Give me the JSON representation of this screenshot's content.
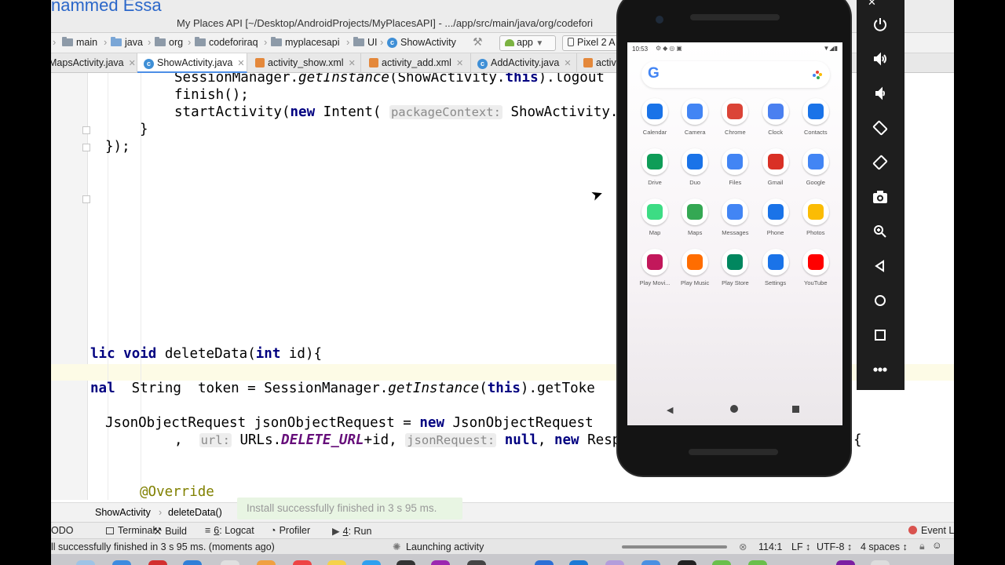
{
  "presenter_name": "nammed Essa",
  "window_title": "My Places API [~/Desktop/AndroidProjects/MyPlacesAPI] - .../app/src/main/java/org/codefori",
  "navbar": {
    "crumbs": [
      "main",
      "java",
      "org",
      "codeforiraq",
      "myplacesapi",
      "UI",
      "ShowActivity"
    ],
    "run_config": "app",
    "device": "Pixel 2 A"
  },
  "tabs": [
    {
      "label": "MapsActivity.java",
      "type": "class"
    },
    {
      "label": "ShowActivity.java",
      "type": "class",
      "active": true
    },
    {
      "label": "activity_show.xml",
      "type": "xml"
    },
    {
      "label": "activity_add.xml",
      "type": "xml"
    },
    {
      "label": "AddActivity.java",
      "type": "class"
    },
    {
      "label": "activi",
      "type": "xml"
    }
  ],
  "code": {
    "line1_a": "SessionManager.",
    "line1_b": "getInstance",
    "line1_c": "(ShowActivity.",
    "line1_d": "this",
    "line1_e": ").logout",
    "line2": "finish();",
    "line3_a": "startActivity(",
    "line3_b": "new",
    "line3_c": " Intent( ",
    "line3_hint": "packageContext:",
    "line3_d": " ShowActivity.",
    "line4": "}",
    "line5": "});",
    "line6_a": "lic",
    "line6_b": "void",
    "line6_c": " deleteData(",
    "line6_d": "int",
    "line6_e": " id){",
    "line7_a": "nal",
    "line7_b": "  String  token = SessionManager.",
    "line7_c": "getInstance",
    "line7_d": "(",
    "line7_e": "this",
    "line7_f": ").getToke",
    "line8_a": "JsonObjectRequest jsonObjectRequest = ",
    "line8_b": "new",
    "line8_c": " JsonObjectRequest",
    "line9_a": ", ",
    "line9_hint1": "url:",
    "line9_b": " URLs.",
    "line9_c": "DELETE_URL",
    "line9_d": "+id, ",
    "line9_hint2": "jsonRequest:",
    "line9_e": "null",
    "line9_f": ", ",
    "line9_g": "new",
    "line9_h": " Respo",
    "line9_brace": "{",
    "line10": "@Override"
  },
  "toast": "Install successfully finished in 3 s 95 ms.",
  "code_breadcrumb": [
    "ShowActivity",
    "deleteData()"
  ],
  "tool_windows": {
    "todo": "ODO",
    "terminal": "Terminal",
    "build": "Build",
    "logcat_num": "6",
    "logcat": ": Logcat",
    "profiler": "Profiler",
    "run_num": "4",
    "run": ": Run",
    "event_log": "Event Lo"
  },
  "status": {
    "message": "ll successfully finished in 3 s 95 ms. (moments ago)",
    "task": "Launching activity",
    "position": "114:1",
    "line_sep": "LF ↕",
    "encoding": "UTF-8 ↕",
    "indent": "4 spaces ↕"
  },
  "phone": {
    "time": "10:53",
    "apps": [
      {
        "label": "Calendar",
        "icon": "calendar-icon",
        "color": "#1a73e8"
      },
      {
        "label": "Camera",
        "icon": "camera-icon",
        "color": "#4285f4"
      },
      {
        "label": "Chrome",
        "icon": "chrome-icon",
        "color": "#db4437"
      },
      {
        "label": "Clock",
        "icon": "clock-icon",
        "color": "#4a80f0"
      },
      {
        "label": "Contacts",
        "icon": "contacts-icon",
        "color": "#1a73e8"
      },
      {
        "label": "Drive",
        "icon": "drive-icon",
        "color": "#0f9d58"
      },
      {
        "label": "Duo",
        "icon": "duo-icon",
        "color": "#1a73e8"
      },
      {
        "label": "Files",
        "icon": "files-icon",
        "color": "#4285f4"
      },
      {
        "label": "Gmail",
        "icon": "gmail-icon",
        "color": "#d93025"
      },
      {
        "label": "Google",
        "icon": "google-icon",
        "color": "#4285f4"
      },
      {
        "label": "Map",
        "icon": "android-icon",
        "color": "#3ddc84"
      },
      {
        "label": "Maps",
        "icon": "maps-icon",
        "color": "#34a853"
      },
      {
        "label": "Messages",
        "icon": "messages-icon",
        "color": "#4285f4"
      },
      {
        "label": "Phone",
        "icon": "phone-icon",
        "color": "#1a73e8"
      },
      {
        "label": "Photos",
        "icon": "photos-icon",
        "color": "#fbbc04"
      },
      {
        "label": "Play Movi...",
        "icon": "play-movies-icon",
        "color": "#c2185b"
      },
      {
        "label": "Play Music",
        "icon": "play-music-icon",
        "color": "#ff6d00"
      },
      {
        "label": "Play Store",
        "icon": "play-store-icon",
        "color": "#01875f"
      },
      {
        "label": "Settings",
        "icon": "settings-icon",
        "color": "#1a73e8"
      },
      {
        "label": "YouTube",
        "icon": "youtube-icon",
        "color": "#ff0000"
      }
    ]
  }
}
